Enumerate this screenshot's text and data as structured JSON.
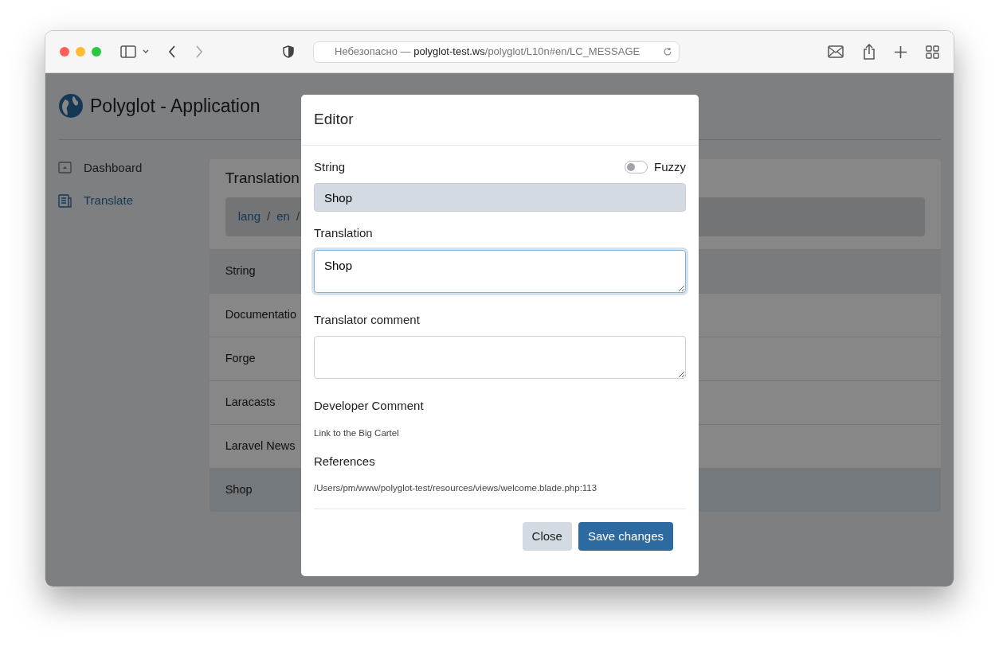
{
  "browser": {
    "url": {
      "label": "Небезопасно —",
      "host": "polyglot-test.ws",
      "path": "/polyglot/L10n#en/LC_MESSAGE"
    }
  },
  "app": {
    "title": "Polyglot - Application"
  },
  "sidebar": {
    "items": [
      {
        "label": "Dashboard",
        "selected": false,
        "kind": "dashboard"
      },
      {
        "label": "Translate",
        "selected": true,
        "kind": "translate"
      }
    ]
  },
  "card": {
    "title": "Translation",
    "breadcrumb": [
      {
        "kind": "link",
        "label": "lang"
      },
      {
        "kind": "separator",
        "label": "/"
      },
      {
        "kind": "link",
        "label": "en"
      },
      {
        "kind": "separator",
        "label": "/"
      }
    ],
    "table": {
      "header": "String",
      "rows": [
        {
          "label": "Documentatio",
          "selected": false
        },
        {
          "label": "Forge",
          "selected": false
        },
        {
          "label": "Laracasts",
          "selected": false
        },
        {
          "label": "Laravel News",
          "selected": false
        },
        {
          "label": "Shop",
          "selected": true
        }
      ]
    }
  },
  "modal": {
    "title": "Editor",
    "string_label": "String",
    "fuzzy": {
      "label": "Fuzzy",
      "on": false
    },
    "string_value": "Shop",
    "translation_label": "Translation",
    "translation_value": "Shop",
    "comment_label": "Translator comment",
    "developer_label": "Developer Comment",
    "developer_comment": "Link to the Big Cartel",
    "references_label": "References",
    "reference": "/Users/pm/www/polyglot-test/resources/views/welcome.blade.php:113",
    "buttons": [
      {
        "label": "Close",
        "kind": "secondary"
      },
      {
        "label": "Save changes",
        "kind": "primary"
      }
    ]
  }
}
